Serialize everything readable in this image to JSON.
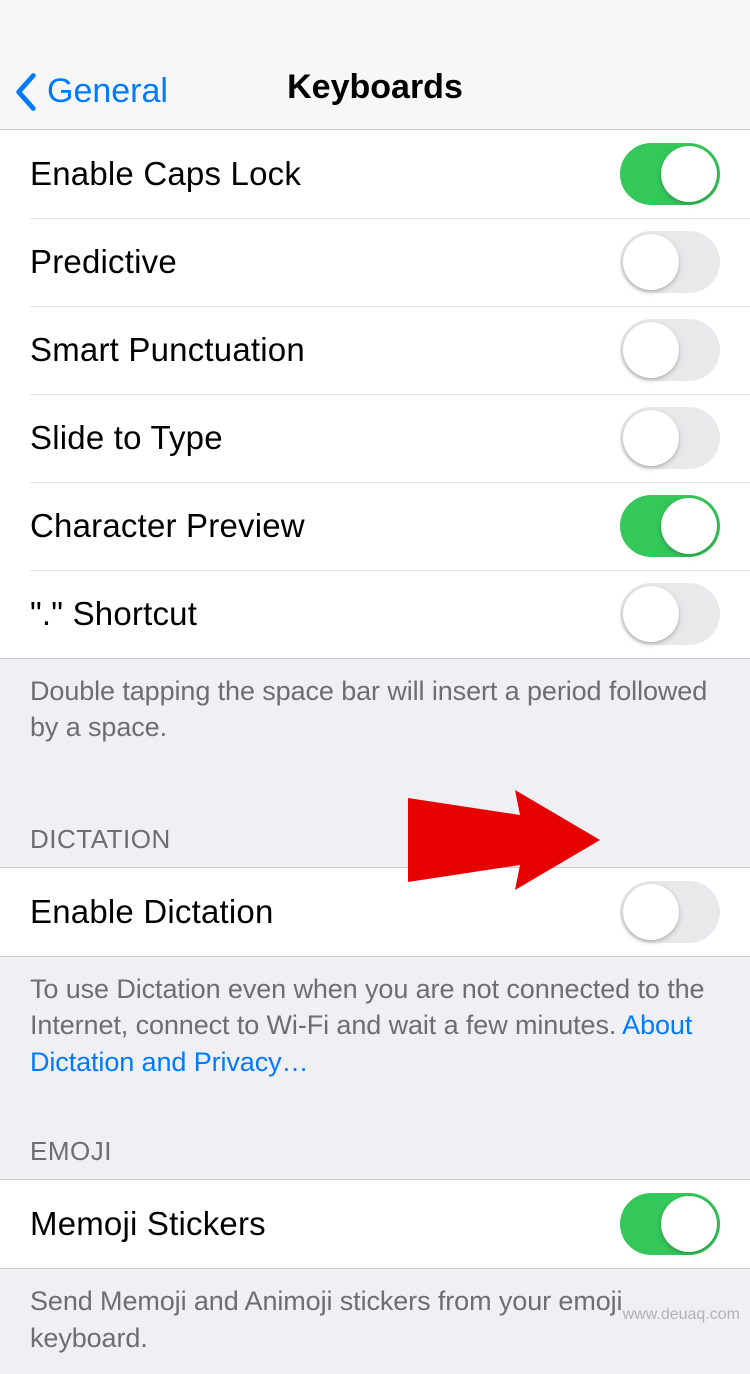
{
  "nav": {
    "back_label": "General",
    "title": "Keyboards"
  },
  "settings_group1": [
    {
      "label": "Enable Caps Lock",
      "value": true
    },
    {
      "label": "Predictive",
      "value": false
    },
    {
      "label": "Smart Punctuation",
      "value": false
    },
    {
      "label": "Slide to Type",
      "value": false
    },
    {
      "label": "Character Preview",
      "value": true
    },
    {
      "label": "\".\" Shortcut",
      "value": false
    }
  ],
  "footer1": "Double tapping the space bar will insert a period followed by a space.",
  "dictation_header": "DICTATION",
  "dictation_group": [
    {
      "label": "Enable Dictation",
      "value": false
    }
  ],
  "dictation_footer_text": "To use Dictation even when you are not connected to the Internet, connect to Wi-Fi and wait a few minutes. ",
  "dictation_footer_link": "About Dictation and Privacy…",
  "emoji_header": "EMOJI",
  "emoji_group": [
    {
      "label": "Memoji Stickers",
      "value": true
    }
  ],
  "emoji_footer": "Send Memoji and Animoji stickers from your emoji keyboard.",
  "watermark": "www.deuaq.com"
}
